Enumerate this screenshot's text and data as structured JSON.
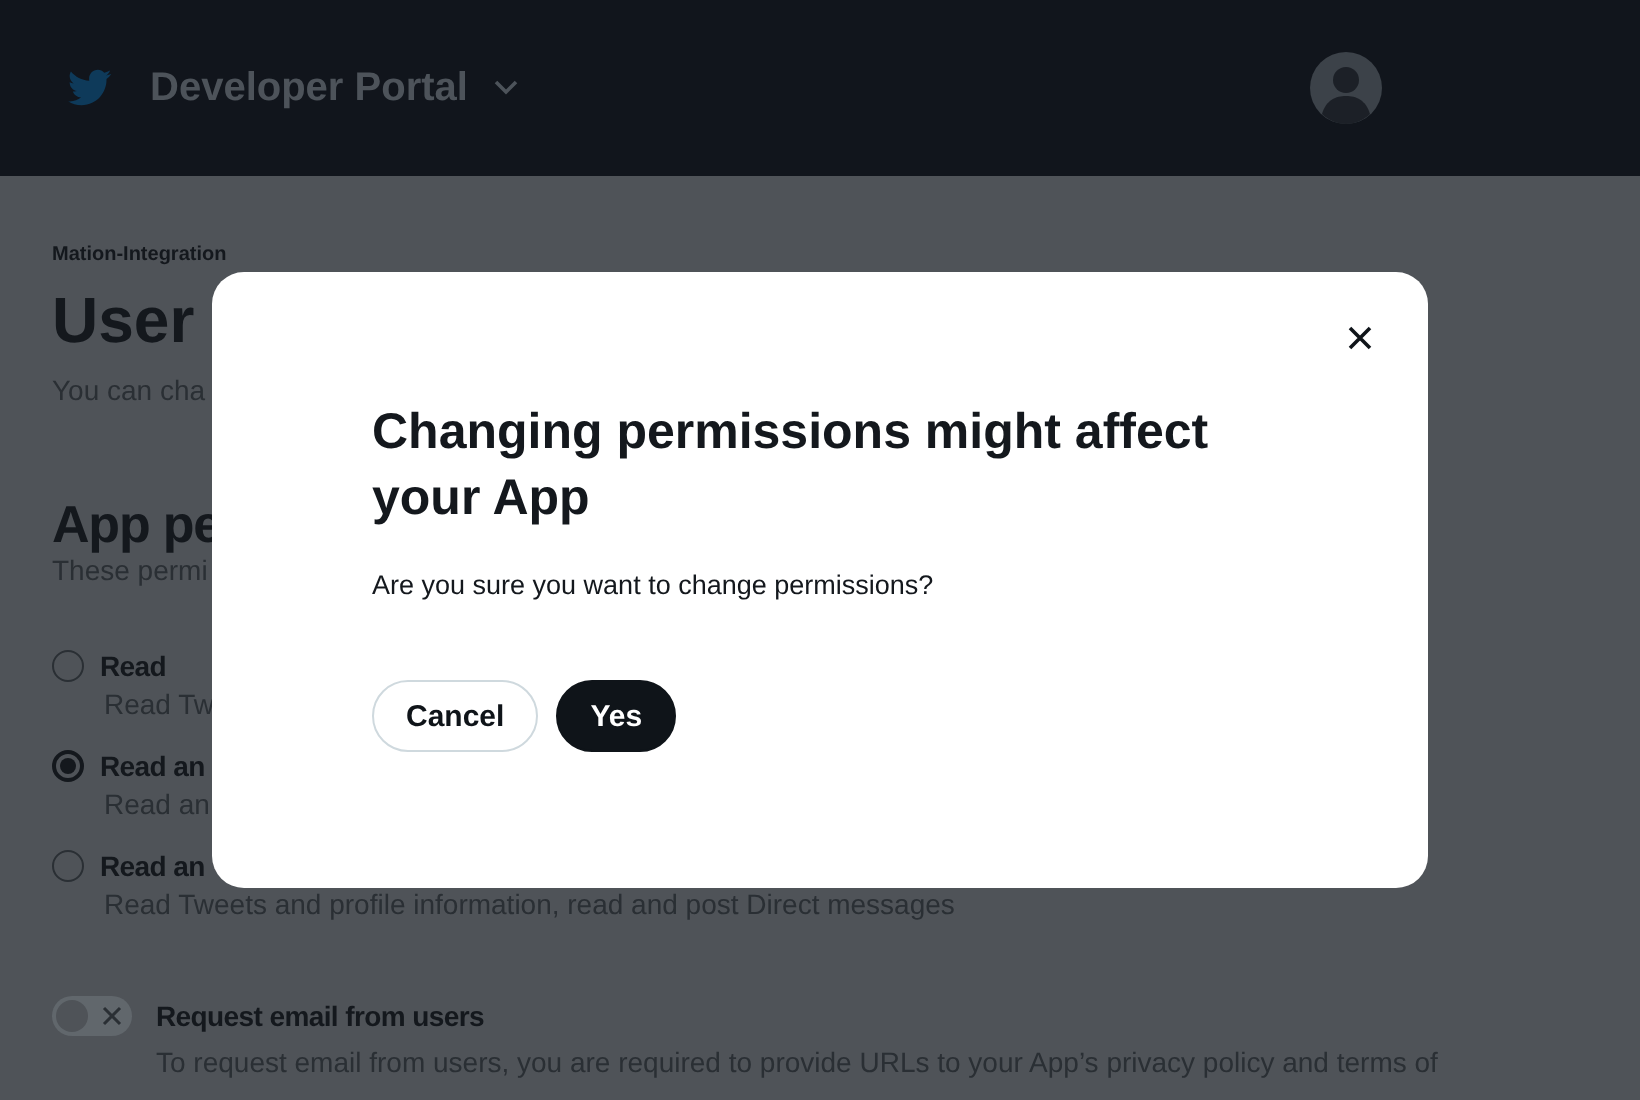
{
  "header": {
    "title": "Developer Portal"
  },
  "page": {
    "breadcrumb": "Mation-Integration",
    "title": "User",
    "intro": "You can cha",
    "section_title": "App pe",
    "section_intro": "These permi",
    "options": [
      {
        "label": "Read",
        "description": "Read Tw",
        "selected": false
      },
      {
        "label": "Read an",
        "description": "Read an",
        "selected": true
      },
      {
        "label": "Read an",
        "description": "Read Tweets and profile information, read and post Direct messages",
        "selected": false
      }
    ],
    "email_toggle": {
      "label": "Request email from users",
      "on": false,
      "description": "To request email from users, you are required to provide URLs to your App’s privacy policy and terms of"
    }
  },
  "dialog": {
    "title": "Changing permissions might affect your App",
    "message": "Are you sure you want to change permissions?",
    "buttons": [
      {
        "label": "Cancel",
        "kind": "secondary"
      },
      {
        "label": "Yes",
        "kind": "primary"
      }
    ]
  }
}
